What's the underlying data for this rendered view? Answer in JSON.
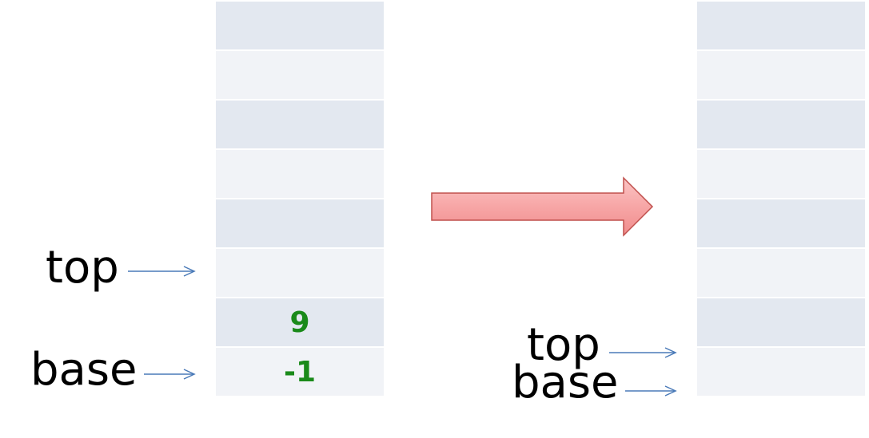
{
  "left_stack": {
    "cells": [
      "",
      "",
      "",
      "",
      "",
      "",
      "9",
      "-1"
    ]
  },
  "right_stack": {
    "cells": [
      "",
      "",
      "",
      "",
      "",
      "",
      "",
      ""
    ]
  },
  "left_labels": {
    "top": "top",
    "base": "base"
  },
  "right_labels": {
    "top": "top",
    "base": "base"
  },
  "colors": {
    "cell_dark": "#e3e8f0",
    "cell_light": "#f1f3f7",
    "value_text": "#1a8a1a",
    "pointer_arrow": "#4a7ab8",
    "big_arrow_fill": "#f7a6a6",
    "big_arrow_stroke": "#c0504d"
  },
  "icons": {
    "transition": "right-arrow-icon",
    "pointer": "pointer-arrow-icon"
  }
}
